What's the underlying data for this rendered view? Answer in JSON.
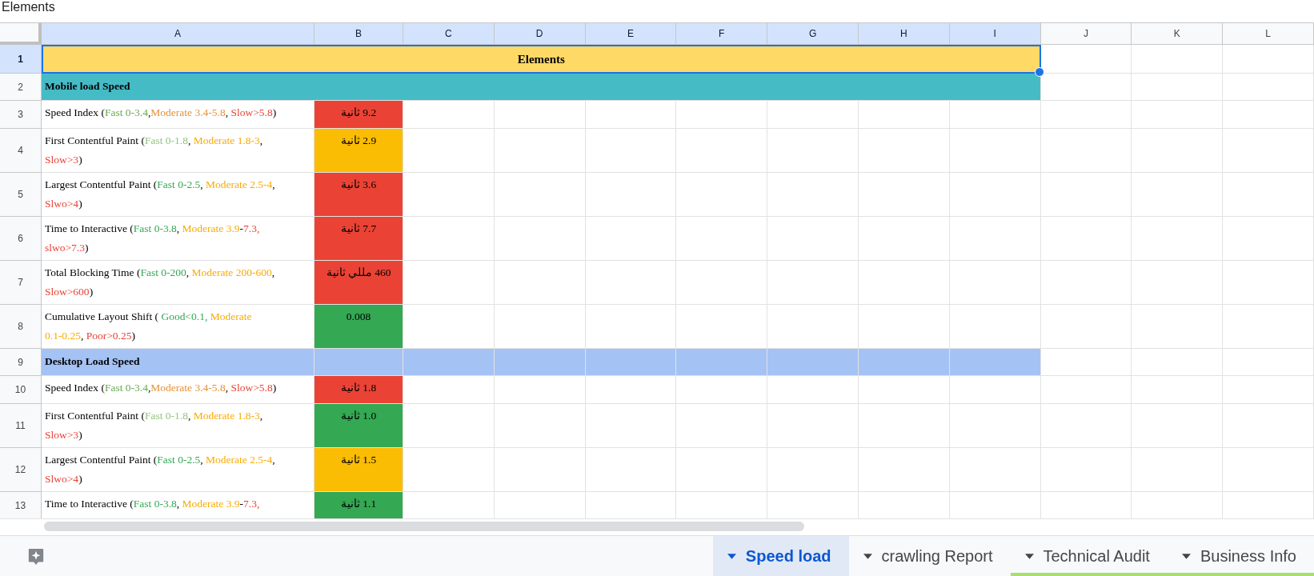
{
  "document_title": "Elements",
  "columns": [
    {
      "label": "A",
      "selected": true
    },
    {
      "label": "B",
      "selected": true
    },
    {
      "label": "C",
      "selected": true
    },
    {
      "label": "D",
      "selected": true
    },
    {
      "label": "E",
      "selected": true
    },
    {
      "label": "F",
      "selected": true
    },
    {
      "label": "G",
      "selected": true
    },
    {
      "label": "H",
      "selected": true
    },
    {
      "label": "I",
      "selected": true
    },
    {
      "label": "J",
      "selected": false
    },
    {
      "label": "K",
      "selected": false
    },
    {
      "label": "L",
      "selected": false
    }
  ],
  "rows": [
    {
      "number": "1",
      "selected": true,
      "kind": "title",
      "text": "Elements",
      "color": "#ffd966"
    },
    {
      "number": "2",
      "selected": false,
      "kind": "section",
      "merged": true,
      "text": "Mobile load Speed",
      "color": "#45bbc6"
    },
    {
      "number": "3",
      "selected": false,
      "kind": "metric",
      "lines": [
        [
          {
            "text": "Speed Index ("
          },
          {
            "text": "Fast 0-3.4",
            "color": "#6aa84f"
          },
          {
            "text": ","
          },
          {
            "text": "Moderate 3.4-5.8",
            "color": "#e69138"
          },
          {
            "text": ", "
          },
          {
            "text": "Slow>5.8",
            "color": "#ea4335"
          },
          {
            "text": ")"
          }
        ]
      ],
      "value": "9.2 ثانية",
      "color": "#ea4335"
    },
    {
      "number": "4",
      "selected": false,
      "kind": "metric",
      "lines": [
        [
          {
            "text": "First Contentful Paint ("
          },
          {
            "text": "Fast 0-1.8",
            "color": "#93c47d"
          },
          {
            "text": ", "
          },
          {
            "text": "Moderate 1.8-3",
            "color": "#f9ab00"
          },
          {
            "text": ","
          }
        ],
        [
          {
            "text": "Slow>3",
            "color": "#ea4335"
          },
          {
            "text": ")"
          }
        ]
      ],
      "value": "2.9 ثانية",
      "color": "#fbbc04"
    },
    {
      "number": "5",
      "selected": false,
      "kind": "metric",
      "lines": [
        [
          {
            "text": "Largest Contentful Paint ("
          },
          {
            "text": "Fast 0-2.5",
            "color": "#34a853"
          },
          {
            "text": ", "
          },
          {
            "text": "Moderate 2.5-4",
            "color": "#f9ab00"
          },
          {
            "text": ","
          }
        ],
        [
          {
            "text": "Slwo>4",
            "color": "#ea4335"
          },
          {
            "text": ")"
          }
        ]
      ],
      "value": "3.6 ثانية",
      "color": "#ea4335"
    },
    {
      "number": "6",
      "selected": false,
      "kind": "metric",
      "lines": [
        [
          {
            "text": "Time to Interactive ("
          },
          {
            "text": "Fast 0-3.8",
            "color": "#34a853"
          },
          {
            "text": ", "
          },
          {
            "text": "Moderate 3.9",
            "color": "#f9ab00"
          },
          {
            "text": "-"
          },
          {
            "text": "7.3,",
            "color": "#ea4335"
          }
        ],
        [
          {
            "text": "slwo>7.3",
            "color": "#ea4335"
          },
          {
            "text": ")"
          }
        ]
      ],
      "value": "7.7 ثانية",
      "color": "#ea4335"
    },
    {
      "number": "7",
      "selected": false,
      "kind": "metric",
      "lines": [
        [
          {
            "text": "Total Blocking Time ("
          },
          {
            "text": "Fast 0-200",
            "color": "#34a853"
          },
          {
            "text": ", "
          },
          {
            "text": "Moderate 200-600",
            "color": "#f9ab00"
          },
          {
            "text": ","
          }
        ],
        [
          {
            "text": "Slow>600",
            "color": "#ea4335"
          },
          {
            "text": ")"
          }
        ]
      ],
      "value": "460 مللي ثانية",
      "color": "#ea4335"
    },
    {
      "number": "8",
      "selected": false,
      "kind": "metric",
      "lines": [
        [
          {
            "text": "Cumulative Layout Shift ( "
          },
          {
            "text": "Good<0.1, ",
            "color": "#34a853"
          },
          {
            "text": "Moderate",
            "color": "#f9ab00"
          }
        ],
        [
          {
            "text": "0.1-0.25",
            "color": "#f9ab00"
          },
          {
            "text": ", "
          },
          {
            "text": "Poor>0.25",
            "color": "#ea4335"
          },
          {
            "text": ")"
          }
        ]
      ],
      "value": "0.008",
      "color": "#34a853"
    },
    {
      "number": "9",
      "selected": false,
      "kind": "section",
      "merged": false,
      "text": "Desktop Load Speed",
      "color": "#a4c2f4"
    },
    {
      "number": "10",
      "selected": false,
      "kind": "metric",
      "lines": [
        [
          {
            "text": "Speed Index ("
          },
          {
            "text": "Fast 0-3.4",
            "color": "#6aa84f"
          },
          {
            "text": ","
          },
          {
            "text": "Moderate 3.4-5.8",
            "color": "#e69138"
          },
          {
            "text": ", "
          },
          {
            "text": "Slow>5.8",
            "color": "#ea4335"
          },
          {
            "text": ")"
          }
        ]
      ],
      "value": "1.8 ثانية",
      "color": "#ea4335"
    },
    {
      "number": "11",
      "selected": false,
      "kind": "metric",
      "lines": [
        [
          {
            "text": "First Contentful Paint ("
          },
          {
            "text": "Fast 0-1.8",
            "color": "#93c47d"
          },
          {
            "text": ", "
          },
          {
            "text": "Moderate 1.8-3",
            "color": "#f9ab00"
          },
          {
            "text": ","
          }
        ],
        [
          {
            "text": "Slow>3",
            "color": "#ea4335"
          },
          {
            "text": ")"
          }
        ]
      ],
      "value": "1.0 ثانية",
      "color": "#34a853"
    },
    {
      "number": "12",
      "selected": false,
      "kind": "metric",
      "lines": [
        [
          {
            "text": "Largest Contentful Paint ("
          },
          {
            "text": "Fast 0-2.5",
            "color": "#34a853"
          },
          {
            "text": ", "
          },
          {
            "text": "Moderate 2.5-4",
            "color": "#f9ab00"
          },
          {
            "text": ","
          }
        ],
        [
          {
            "text": "Slwo>4",
            "color": "#ea4335"
          },
          {
            "text": ")"
          }
        ]
      ],
      "value": "1.5 ثانية",
      "color": "#fbbc04"
    },
    {
      "number": "13",
      "selected": false,
      "kind": "metric",
      "lines": [
        [
          {
            "text": "Time to Interactive ("
          },
          {
            "text": "Fast 0-3.8",
            "color": "#34a853"
          },
          {
            "text": ", "
          },
          {
            "text": "Moderate 3.9",
            "color": "#f9ab00"
          },
          {
            "text": "-"
          },
          {
            "text": "7.3,",
            "color": "#ea4335"
          }
        ]
      ],
      "value": "1.1 ثانية",
      "color": "#34a853"
    }
  ],
  "sheet_tabs": [
    {
      "label": "Speed load",
      "selected": true
    },
    {
      "label": "crawling Report",
      "selected": false
    },
    {
      "label": "Technical Audit",
      "selected": false,
      "color": "#a8e06f"
    },
    {
      "label": "Business Info",
      "selected": false,
      "color": "#a8e06f"
    }
  ]
}
